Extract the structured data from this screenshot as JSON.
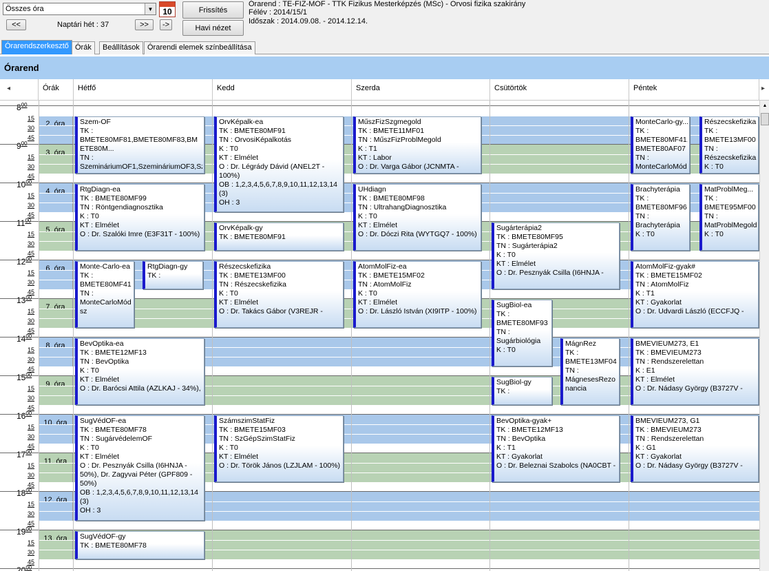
{
  "toolbar": {
    "combo_value": "Összes óra",
    "calendar_day": "10",
    "prev_label": "<<",
    "week_label": "Naptári hét : 37",
    "next_label": ">>",
    "jump_label": "->",
    "refresh_label": "Frissítés",
    "month_view_label": "Havi nézet"
  },
  "info": {
    "line1": "Órarend : TE-FIZ-MOF - TTK Fizikus Mesterképzés (MSc) - Orvosi fizika szakirány",
    "line2": "Félév : 2014/15/1",
    "line3": "Időszak : 2014.09.08. - 2014.12.14."
  },
  "tabs": [
    "Órarendszerkesztő",
    "Órák",
    "Beállítások",
    "Órarendi elemek színbeállítása"
  ],
  "section_title": "Órarend",
  "columns": {
    "hours": "Órák",
    "days": [
      "Hétfő",
      "Kedd",
      "Szerda",
      "Csütörtök",
      "Péntek"
    ]
  },
  "time_hours": [
    "8",
    "9",
    "10",
    "11",
    "12",
    "13",
    "14",
    "15",
    "16",
    "17",
    "18",
    "19",
    "20"
  ],
  "time_minute_labels": [
    "00",
    "15",
    "30",
    "45"
  ],
  "lessons": [
    "2. óra",
    "3. óra",
    "4. óra",
    "5. óra",
    "6. óra",
    "7. óra",
    "8. óra",
    "9. óra",
    "10. óra",
    "11. óra",
    "12. óra",
    "13. óra"
  ],
  "events": {
    "mon_szem": {
      "title": "Szem-OF",
      "l1": "TK :",
      "l2": "BMETE80MF81,BMETE80MF83,BM",
      "l3": "ETE80M...",
      "l4": "TN :",
      "l5": "SzemináriumOF1,SzemináriumOF3,Sz"
    },
    "mon_rtg": {
      "title": "RtgDiagn-ea",
      "l1": "TK : BMETE80MF99",
      "l2": "TN : Röntgendiagnosztika",
      "l3": "K : T0",
      "l4": "KT : Elmélet",
      "l5": "O : Dr. Szalóki Imre (E3F31T - 100%)"
    },
    "mon_montecarlo": {
      "title": "Monte-Carlo-ea",
      "l1": "TK :",
      "l2": "BMETE80MF41",
      "l3": "TN :",
      "l4": "MonteCarloMód",
      "l5": "sz"
    },
    "mon_rtggy": {
      "title": "RtgDiagn-gy",
      "l1": "TK :"
    },
    "mon_bevoptika": {
      "title": "BevOptika-ea",
      "l1": "TK : BMETE12MF13",
      "l2": "TN : BevOptika",
      "l3": "K : T0",
      "l4": "KT : Elmélet",
      "l5": "O : Dr. Barócsi Attila (AZLKAJ - 34%),"
    },
    "mon_sugvedea": {
      "title": "SugVédOF-ea",
      "l1": "TK : BMETE80MF78",
      "l2": "TN : SugárvédelemOF",
      "l3": "K : T0",
      "l4": "KT : Elmélet",
      "l5": "O : Dr. Pesznyák Csilla (I6HNJA -",
      "l6": "50%), Dr. Zagyvai Péter (GPF809 -",
      "l7": "50%)",
      "l8": "OB : 1,2,3,4,5,6,7,8,9,10,11,12,13,14",
      "l9": "(3)",
      "l10": "OH : 3"
    },
    "mon_sugvedgy": {
      "title": "SugVédOF-gy",
      "l1": "TK : BMETE80MF78"
    },
    "tue_orvkep": {
      "title": "OrvKépalk-ea",
      "l1": "TK : BMETE80MF91",
      "l2": "TN : OrvosiKépalkotás",
      "l3": "K : T0",
      "l4": "KT : Elmélet",
      "l5": "O : Dr. Légrády Dávid (ANEL2T -",
      "l6": "100%)",
      "l7": "OB : 1,2,3,4,5,6,7,8,9,10,11,12,13,14",
      "l8": "(3)",
      "l9": "OH : 3"
    },
    "tue_orvkepgy": {
      "title": "OrvKépalk-gy",
      "l1": "TK : BMETE80MF91"
    },
    "tue_reszecske": {
      "title": "Részecskefizika",
      "l1": "TK : BMETE13MF00",
      "l2": "TN : Részecskefizika",
      "l3": "K : T0",
      "l4": "KT : Elmélet",
      "l5": "O : Dr. Takács Gábor (V3REJR -"
    },
    "tue_szamszim": {
      "title": "SzámszimStatFiz",
      "l1": "TK : BMETE15MF03",
      "l2": "TN : SzGépSzimStatFiz",
      "l3": "K : T0",
      "l4": "KT : Elmélet",
      "l5": "O : Dr. Török János (LZJLAM - 100%)"
    },
    "wed_muszfiz": {
      "title": "MűszFizSzgmegold",
      "l1": "TK : BMETE11MF01",
      "l2": "TN : MűszFizProblMegold",
      "l3": "K : T1",
      "l4": "KT : Labor",
      "l5": "O : Dr. Varga Gábor (JCNMTA -"
    },
    "wed_uhdiagn": {
      "title": "UHdiagn",
      "l1": "TK : BMETE80MF98",
      "l2": "TN : UltrahangDiagnosztika",
      "l3": "K : T0",
      "l4": "KT : Elmélet",
      "l5": "O : Dr. Dóczi Rita (WYTGQ7 - 100%)"
    },
    "wed_atommol": {
      "title": "AtomMolFiz-ea",
      "l1": "TK : BMETE15MF02",
      "l2": "TN : AtomMolFiz",
      "l3": "K : T0",
      "l4": "KT : Elmélet",
      "l5": "O : Dr. László István (XI9ITP - 100%)"
    },
    "thu_sugarter": {
      "title": "Sugárterápia2",
      "l1": "TK : BMETE80MF95",
      "l2": "TN : Sugárterápia2",
      "l3": "K : T0",
      "l4": "KT : Elmélet",
      "l5": "O : Dr. Pesznyák Csilla (I6HNJA -"
    },
    "thu_sugbiol": {
      "title": "SugBiol-ea",
      "l1": "TK :",
      "l2": "BMETE80MF93",
      "l3": "TN :",
      "l4": "Sugárbiológia",
      "l5": "K : T0"
    },
    "thu_magnrez": {
      "title": "MágnRez",
      "l1": "TK :",
      "l2": "BMETE13MF04",
      "l3": "TN :",
      "l4": "MágnesesRezo",
      "l5": "nancia"
    },
    "thu_sugbiolgy": {
      "title": "SugBiol-gy",
      "l1": "TK :"
    },
    "thu_bevoptikagy": {
      "title": "BevOptika-gyak+",
      "l1": "TK : BMETE12MF13",
      "l2": "TN : BevOptika",
      "l3": "K : T1",
      "l4": "KT : Gyakorlat",
      "l5": "O : Dr. Beleznai Szabolcs (NA0CBT -"
    },
    "fri_montecarlogy": {
      "title": "MonteCarlo-gy...",
      "l1": "TK :",
      "l2": "BMETE80MF41,",
      "l3": "BMETE80AF07",
      "l4": "TN :",
      "l5": "MonteCarloMód"
    },
    "fri_reszecske": {
      "title": "Részecskefizika",
      "l1": "TK :",
      "l2": "BMETE13MF00",
      "l3": "TN :",
      "l4": "Részecskefizika",
      "l5": "K : T0"
    },
    "fri_brachy": {
      "title": "Brachyterápia",
      "l1": "TK :",
      "l2": "BMETE80MF96",
      "l3": "TN :",
      "l4": "Brachyterápia",
      "l5": "K : T0"
    },
    "fri_matprobl": {
      "title": "MatProblMeg...",
      "l1": "TK :",
      "l2": "BMETE95MF00",
      "l3": "TN :",
      "l4": "MatProblMegold",
      "l5": "K : T0"
    },
    "fri_atommolgy": {
      "title": "AtomMolFiz-gyak#",
      "l1": "TK : BMETE15MF02",
      "l2": "TN : AtomMolFiz",
      "l3": "K : T1",
      "l4": "KT : Gyakorlat",
      "l5": "O : Dr. Udvardi László (ECCFJQ -"
    },
    "fri_bmevieum_e1": {
      "title": "BMEVIEUM273, E1",
      "l1": "TK : BMEVIEUM273",
      "l2": "TN : Rendszerelettan",
      "l3": "K : E1",
      "l4": "KT : Elmélet",
      "l5": "O : Dr. Nádasy György (B3727V -"
    },
    "fri_bmevieum_g1": {
      "title": "BMEVIEUM273, G1",
      "l1": "TK : BMEVIEUM273",
      "l2": "TN : Rendszerelettan",
      "l3": "K : G1",
      "l4": "KT : Gyakorlat",
      "l5": "O : Dr. Nádasy György (B3727V -"
    }
  },
  "colors": {
    "blue_band": "#a9c8ea",
    "green_band": "#b8d2b4",
    "event_accent": "#1a1acc",
    "active_tab": "#3399ff",
    "section_bar": "#a8cdf2"
  }
}
